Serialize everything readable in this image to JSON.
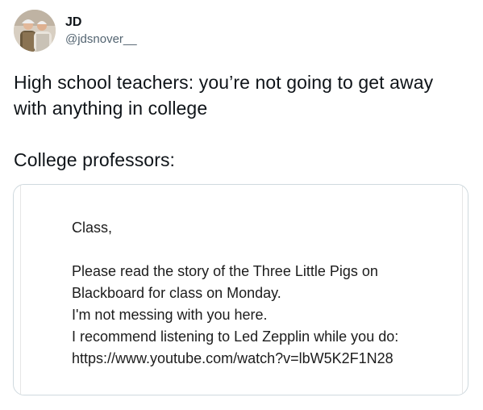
{
  "author": {
    "display_name": "JD",
    "handle": "@jdsnover__",
    "avatar_icon": "profile-photo"
  },
  "tweet": {
    "line1": "High school teachers: you’re not going to get away",
    "line2": "with anything in college",
    "line3": "College professors:"
  },
  "email": {
    "greeting": "Class,",
    "body": [
      "Please read the story of the Three Little Pigs on",
      "Blackboard for class on Monday.",
      "I'm not messing with you here.",
      "I recommend listening to Led Zepplin while you do:",
      "https://www.youtube.com/watch?v=lbW5K2F1N28"
    ]
  },
  "colors": {
    "text": "#0f1419",
    "secondary": "#536471",
    "border": "#cfd9de"
  }
}
